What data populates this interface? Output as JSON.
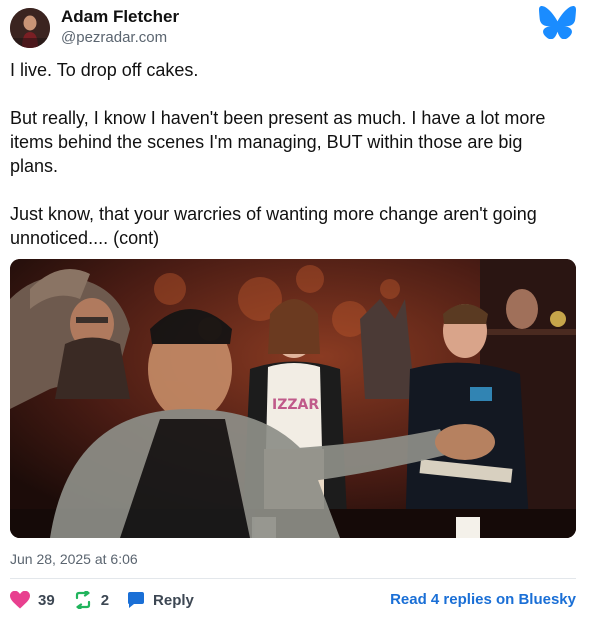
{
  "post": {
    "author_name": "Adam Fletcher",
    "author_handle": "@pezradar.com",
    "paragraphs": [
      "I live. To drop off cakes.",
      "But really, I know I haven't been present as much. I have a lot more items behind the scenes I'm managing, BUT within those are big plans.",
      "Just know, that your warcries of wanting more change aren't going unnoticed.... (cont)"
    ],
    "timestamp": "Jun 28, 2025 at 6:06"
  },
  "actions": {
    "likes": "39",
    "reposts": "2",
    "reply_label": "Reply",
    "read_replies_label": "Read 4 replies on Bluesky"
  },
  "media": {
    "shirt_print": "IZZAR"
  },
  "colors": {
    "like": "#e8408f",
    "repost": "#20b45c",
    "reply": "#1a6fd6",
    "bluesky_brand": "#1a8cff"
  },
  "icons": {
    "brand": "butterfly-icon",
    "like": "heart-icon",
    "repost": "repost-icon",
    "reply": "speech-bubble-icon"
  }
}
